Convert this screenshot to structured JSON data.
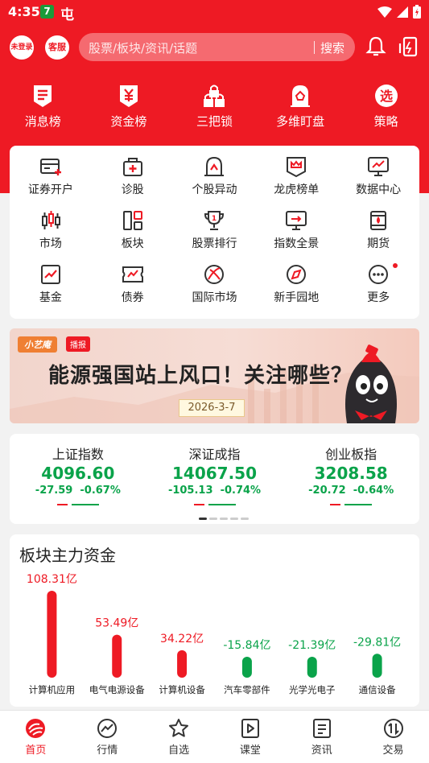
{
  "status_bar": {
    "time": "4:35",
    "app_icon_1": "7",
    "app_icon_2": "屯"
  },
  "header": {
    "login_label": "未登录",
    "service_label": "客服",
    "search_placeholder": "股票/板块/资讯/话题",
    "search_button": "搜索",
    "bell_icon": "bell-icon",
    "phone_icon": "phone-icon"
  },
  "top_nav": [
    {
      "label": "消息榜",
      "icon": "doc-list-icon"
    },
    {
      "label": "资金榜",
      "icon": "yen-tag-icon"
    },
    {
      "label": "三把锁",
      "icon": "locks-icon"
    },
    {
      "label": "多维盯盘",
      "icon": "house-monitor-icon"
    },
    {
      "label": "策略",
      "icon": "select-circle-icon"
    }
  ],
  "grid": [
    {
      "label": "证券开户",
      "icon": "card-plus-icon"
    },
    {
      "label": "诊股",
      "icon": "medical-bag-icon"
    },
    {
      "label": "个股异动",
      "icon": "stock-alert-icon"
    },
    {
      "label": "龙虎榜单",
      "icon": "crown-badge-icon"
    },
    {
      "label": "数据中心",
      "icon": "monitor-chart-icon"
    },
    {
      "label": "市场",
      "icon": "candlestick-icon"
    },
    {
      "label": "板块",
      "icon": "blocks-icon"
    },
    {
      "label": "股票排行",
      "icon": "trophy-icon"
    },
    {
      "label": "指数全景",
      "icon": "screen-arrow-icon"
    },
    {
      "label": "期货",
      "icon": "oil-drop-icon"
    },
    {
      "label": "基金",
      "icon": "trend-box-icon"
    },
    {
      "label": "债券",
      "icon": "bond-ticket-icon"
    },
    {
      "label": "国际市场",
      "icon": "globe-icon"
    },
    {
      "label": "新手园地",
      "icon": "compass-icon"
    },
    {
      "label": "更多",
      "icon": "more-dots-icon"
    }
  ],
  "banner": {
    "tag": "小艺庵",
    "tag2": "播报",
    "title": "能源强国站上风口！关注哪些？",
    "date": "2026-3-7"
  },
  "indexes": [
    {
      "name": "上证指数",
      "value": "4096.60",
      "change": "-27.59",
      "percent": "-0.67%"
    },
    {
      "name": "深证成指",
      "value": "14067.50",
      "change": "-105.13",
      "percent": "-0.74%"
    },
    {
      "name": "创业板指",
      "value": "3208.58",
      "change": "-20.72",
      "percent": "-0.64%"
    }
  ],
  "capital_flow": {
    "title": "板块主力资金",
    "colors": {
      "positive": "#ee1a24",
      "negative": "#0aa34a"
    }
  },
  "chart_data": {
    "type": "bar",
    "title": "板块主力资金",
    "categories": [
      "计算机应用",
      "电气电源设备",
      "计算机设备",
      "汽车零部件",
      "光学光电子",
      "通信设备"
    ],
    "values": [
      108.31,
      53.49,
      34.22,
      -15.84,
      -21.39,
      -29.81
    ],
    "value_labels": [
      "108.31亿",
      "53.49亿",
      "34.22亿",
      "-15.84亿",
      "-21.39亿",
      "-29.81亿"
    ],
    "unit": "亿"
  },
  "tabs": [
    {
      "label": "首页",
      "icon": "home-logo-icon",
      "active": true
    },
    {
      "label": "行情",
      "icon": "trend-circle-icon",
      "active": false
    },
    {
      "label": "自选",
      "icon": "star-icon",
      "active": false
    },
    {
      "label": "课堂",
      "icon": "play-screen-icon",
      "active": false
    },
    {
      "label": "资讯",
      "icon": "news-icon",
      "active": false
    },
    {
      "label": "交易",
      "icon": "exchange-icon",
      "active": false
    }
  ]
}
